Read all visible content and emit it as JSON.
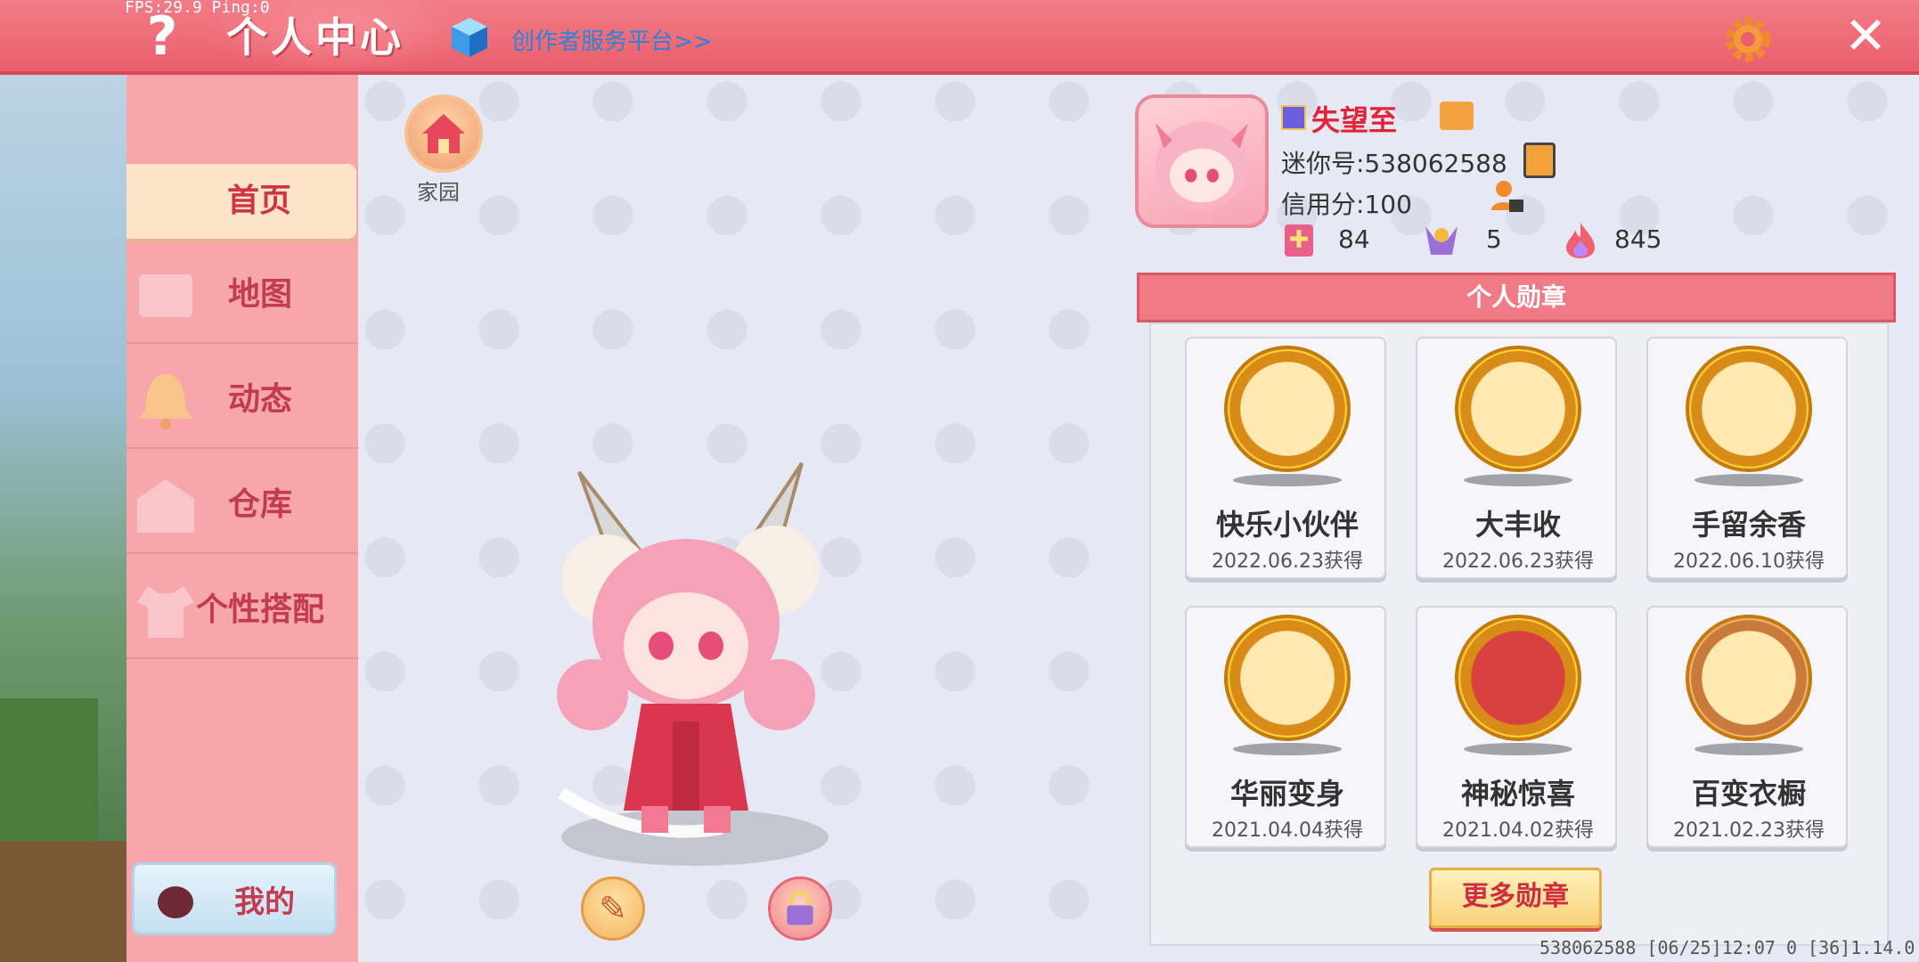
{
  "debug": {
    "fps_text": "FPS:29.9  Ping:0"
  },
  "header": {
    "help_label": "?",
    "title": "个人中心",
    "creator_link": "创作者服务平台>>",
    "close_label": "✕"
  },
  "sidebar": {
    "items": [
      {
        "label": "首页"
      },
      {
        "label": "地图"
      },
      {
        "label": "动态"
      },
      {
        "label": "仓库"
      },
      {
        "label": "个性搭配"
      }
    ],
    "mine_label": "我的"
  },
  "main": {
    "home_label": "家园",
    "edit_icon": "✎"
  },
  "profile": {
    "name": "失望至",
    "mini_id": "迷你号:538062588",
    "credit": "信用分:100",
    "stats": [
      {
        "icon": "flower-icon",
        "value": "84"
      },
      {
        "icon": "fans-icon",
        "value": "5"
      },
      {
        "icon": "fire-icon",
        "value": "845"
      }
    ]
  },
  "medals": {
    "header": "个人勋章",
    "items": [
      {
        "name": "快乐小伙伴",
        "date": "2022.06.23获得"
      },
      {
        "name": "大丰收",
        "date": "2022.06.23获得"
      },
      {
        "name": "手留余香",
        "date": "2022.06.10获得"
      },
      {
        "name": "华丽变身",
        "date": "2021.04.04获得"
      },
      {
        "name": "神秘惊喜",
        "date": "2021.04.02获得"
      },
      {
        "name": "百变衣橱",
        "date": "2021.02.23获得"
      }
    ],
    "more_label": "更多勋章"
  },
  "footer": {
    "text": "538062588   [06/25]12:07 0   [36]1.14.0"
  },
  "colors": {
    "accent": "#ea5f6c",
    "title_red": "#c23b4f",
    "link_blue": "#2e83d6"
  }
}
